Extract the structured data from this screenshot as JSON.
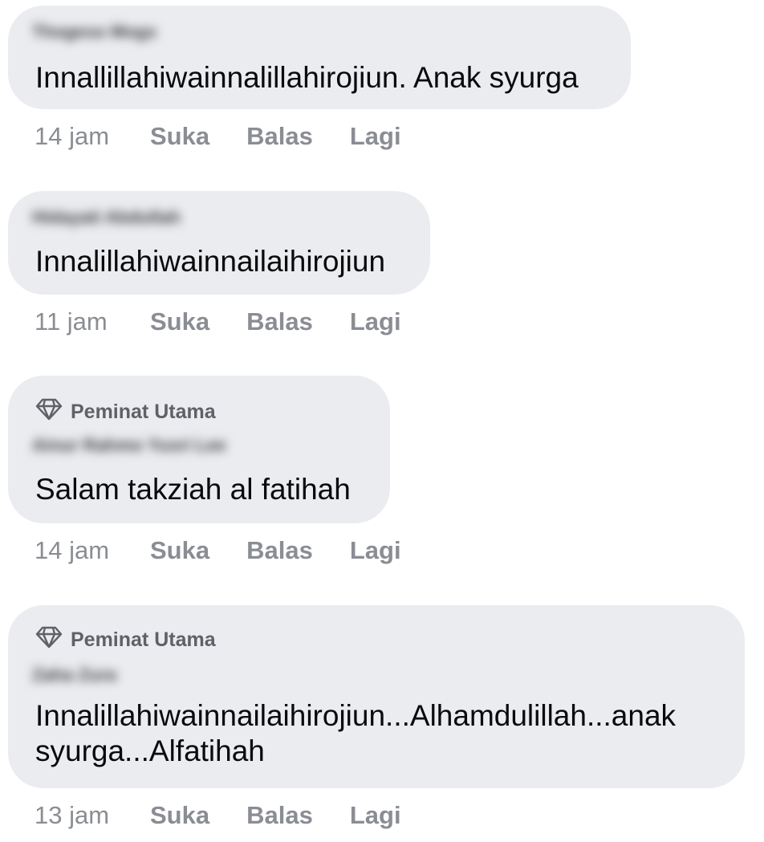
{
  "comments": [
    {
      "badge": "",
      "author": "Thogeso Mogs",
      "text": "Innallillahiwainnalillahirojiun. Anak syurga",
      "time": "14 jam",
      "like": "Suka",
      "reply": "Balas",
      "more": "Lagi"
    },
    {
      "badge": "",
      "author": "Hidayati Abdullah",
      "text": "Innalillahiwainnailaihirojiun",
      "time": "11 jam",
      "like": "Suka",
      "reply": "Balas",
      "more": "Lagi"
    },
    {
      "badge": "Peminat Utama",
      "author": "Ainur Rahmo Yusri Lee",
      "text": "Salam takziah al fatihah",
      "time": "14 jam",
      "like": "Suka",
      "reply": "Balas",
      "more": "Lagi"
    },
    {
      "badge": "Peminat Utama",
      "author": "Zaha Zura",
      "text": "Innalillahiwainnailaihirojiun...Alhamdulillah...anak\nsyurga...Alfatihah",
      "time": "13 jam",
      "like": "Suka",
      "reply": "Balas",
      "more": "Lagi"
    }
  ],
  "icons": {
    "badge": "diamond-icon"
  },
  "colors": {
    "bubble": "#ebecf0",
    "action_text": "#8a8d93",
    "badge_text": "#5e6167",
    "comment_text": "#0a0a0b"
  }
}
